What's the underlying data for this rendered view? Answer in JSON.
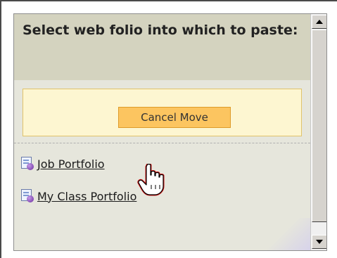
{
  "panel": {
    "title": "Select web folio into which to paste:"
  },
  "cancel_move": {
    "label": "Cancel Move"
  },
  "folios": [
    {
      "label": "Job Portfolio",
      "icon": "portfolio-document-icon"
    },
    {
      "label": "My Class Portfolio",
      "icon": "portfolio-document-icon"
    }
  ],
  "cursor": {
    "icon": "hand-pointer-icon"
  },
  "colors": {
    "header_bg": "#d4d3bf",
    "cancel_box_bg": "#fdf6d1",
    "cancel_button_bg": "#fcc560",
    "panel_bg": "#e6e6dc"
  }
}
